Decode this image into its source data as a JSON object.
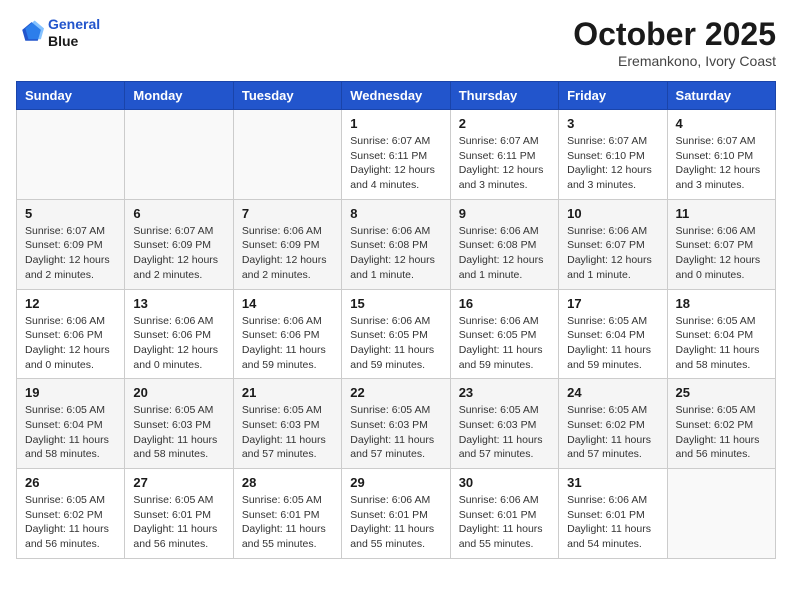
{
  "header": {
    "logo_line1": "General",
    "logo_line2": "Blue",
    "month": "October 2025",
    "location": "Eremankono, Ivory Coast"
  },
  "weekdays": [
    "Sunday",
    "Monday",
    "Tuesday",
    "Wednesday",
    "Thursday",
    "Friday",
    "Saturday"
  ],
  "weeks": [
    [
      {
        "day": "",
        "info": ""
      },
      {
        "day": "",
        "info": ""
      },
      {
        "day": "",
        "info": ""
      },
      {
        "day": "1",
        "info": "Sunrise: 6:07 AM\nSunset: 6:11 PM\nDaylight: 12 hours\nand 4 minutes."
      },
      {
        "day": "2",
        "info": "Sunrise: 6:07 AM\nSunset: 6:11 PM\nDaylight: 12 hours\nand 3 minutes."
      },
      {
        "day": "3",
        "info": "Sunrise: 6:07 AM\nSunset: 6:10 PM\nDaylight: 12 hours\nand 3 minutes."
      },
      {
        "day": "4",
        "info": "Sunrise: 6:07 AM\nSunset: 6:10 PM\nDaylight: 12 hours\nand 3 minutes."
      }
    ],
    [
      {
        "day": "5",
        "info": "Sunrise: 6:07 AM\nSunset: 6:09 PM\nDaylight: 12 hours\nand 2 minutes."
      },
      {
        "day": "6",
        "info": "Sunrise: 6:07 AM\nSunset: 6:09 PM\nDaylight: 12 hours\nand 2 minutes."
      },
      {
        "day": "7",
        "info": "Sunrise: 6:06 AM\nSunset: 6:09 PM\nDaylight: 12 hours\nand 2 minutes."
      },
      {
        "day": "8",
        "info": "Sunrise: 6:06 AM\nSunset: 6:08 PM\nDaylight: 12 hours\nand 1 minute."
      },
      {
        "day": "9",
        "info": "Sunrise: 6:06 AM\nSunset: 6:08 PM\nDaylight: 12 hours\nand 1 minute."
      },
      {
        "day": "10",
        "info": "Sunrise: 6:06 AM\nSunset: 6:07 PM\nDaylight: 12 hours\nand 1 minute."
      },
      {
        "day": "11",
        "info": "Sunrise: 6:06 AM\nSunset: 6:07 PM\nDaylight: 12 hours\nand 0 minutes."
      }
    ],
    [
      {
        "day": "12",
        "info": "Sunrise: 6:06 AM\nSunset: 6:06 PM\nDaylight: 12 hours\nand 0 minutes."
      },
      {
        "day": "13",
        "info": "Sunrise: 6:06 AM\nSunset: 6:06 PM\nDaylight: 12 hours\nand 0 minutes."
      },
      {
        "day": "14",
        "info": "Sunrise: 6:06 AM\nSunset: 6:06 PM\nDaylight: 11 hours\nand 59 minutes."
      },
      {
        "day": "15",
        "info": "Sunrise: 6:06 AM\nSunset: 6:05 PM\nDaylight: 11 hours\nand 59 minutes."
      },
      {
        "day": "16",
        "info": "Sunrise: 6:06 AM\nSunset: 6:05 PM\nDaylight: 11 hours\nand 59 minutes."
      },
      {
        "day": "17",
        "info": "Sunrise: 6:05 AM\nSunset: 6:04 PM\nDaylight: 11 hours\nand 59 minutes."
      },
      {
        "day": "18",
        "info": "Sunrise: 6:05 AM\nSunset: 6:04 PM\nDaylight: 11 hours\nand 58 minutes."
      }
    ],
    [
      {
        "day": "19",
        "info": "Sunrise: 6:05 AM\nSunset: 6:04 PM\nDaylight: 11 hours\nand 58 minutes."
      },
      {
        "day": "20",
        "info": "Sunrise: 6:05 AM\nSunset: 6:03 PM\nDaylight: 11 hours\nand 58 minutes."
      },
      {
        "day": "21",
        "info": "Sunrise: 6:05 AM\nSunset: 6:03 PM\nDaylight: 11 hours\nand 57 minutes."
      },
      {
        "day": "22",
        "info": "Sunrise: 6:05 AM\nSunset: 6:03 PM\nDaylight: 11 hours\nand 57 minutes."
      },
      {
        "day": "23",
        "info": "Sunrise: 6:05 AM\nSunset: 6:03 PM\nDaylight: 11 hours\nand 57 minutes."
      },
      {
        "day": "24",
        "info": "Sunrise: 6:05 AM\nSunset: 6:02 PM\nDaylight: 11 hours\nand 57 minutes."
      },
      {
        "day": "25",
        "info": "Sunrise: 6:05 AM\nSunset: 6:02 PM\nDaylight: 11 hours\nand 56 minutes."
      }
    ],
    [
      {
        "day": "26",
        "info": "Sunrise: 6:05 AM\nSunset: 6:02 PM\nDaylight: 11 hours\nand 56 minutes."
      },
      {
        "day": "27",
        "info": "Sunrise: 6:05 AM\nSunset: 6:01 PM\nDaylight: 11 hours\nand 56 minutes."
      },
      {
        "day": "28",
        "info": "Sunrise: 6:05 AM\nSunset: 6:01 PM\nDaylight: 11 hours\nand 55 minutes."
      },
      {
        "day": "29",
        "info": "Sunrise: 6:06 AM\nSunset: 6:01 PM\nDaylight: 11 hours\nand 55 minutes."
      },
      {
        "day": "30",
        "info": "Sunrise: 6:06 AM\nSunset: 6:01 PM\nDaylight: 11 hours\nand 55 minutes."
      },
      {
        "day": "31",
        "info": "Sunrise: 6:06 AM\nSunset: 6:01 PM\nDaylight: 11 hours\nand 54 minutes."
      },
      {
        "day": "",
        "info": ""
      }
    ]
  ]
}
